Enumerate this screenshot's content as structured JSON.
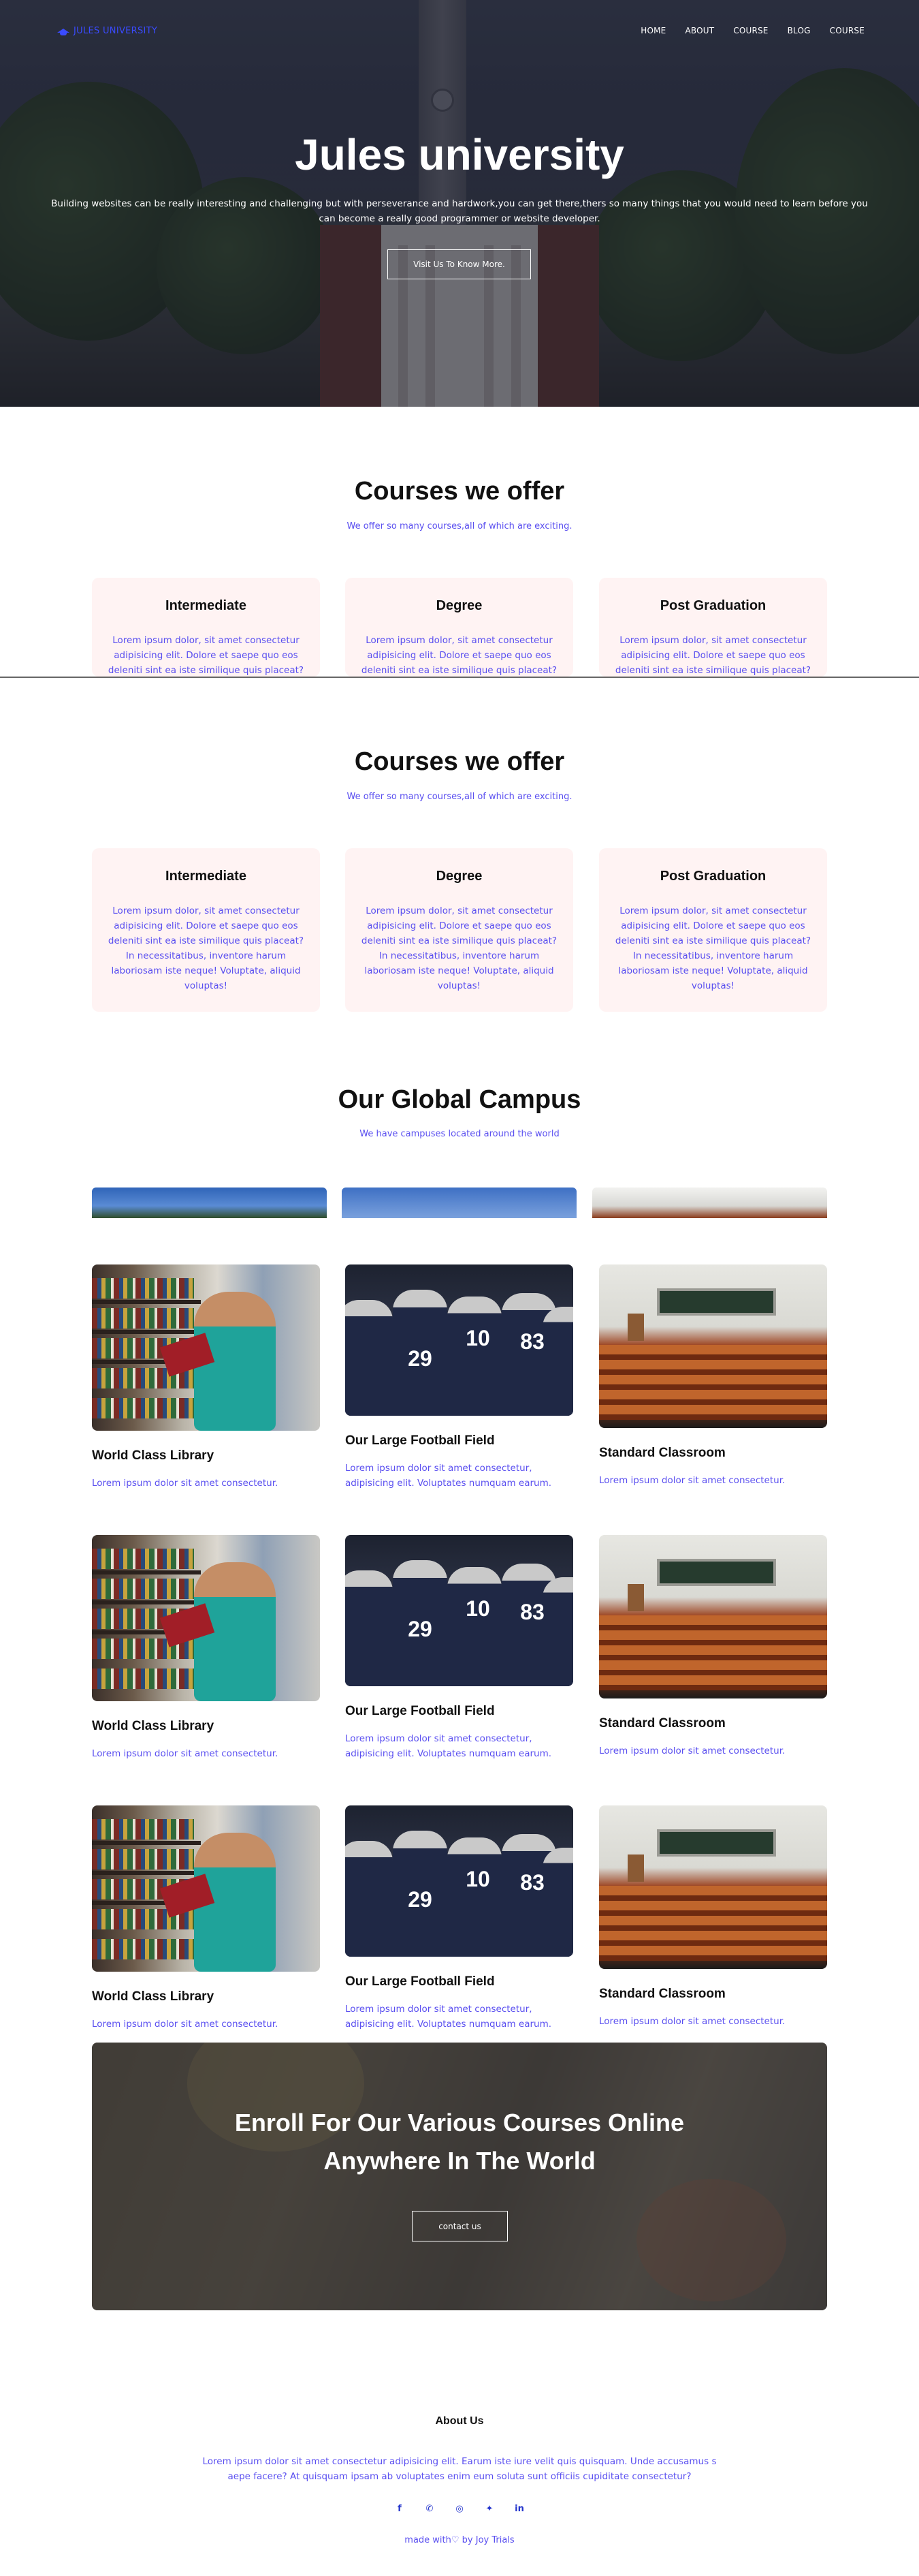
{
  "nav": {
    "brand": "JULES UNIVERSITY",
    "links": [
      "HOME",
      "ABOUT",
      "COURSE",
      "BLOG",
      "COURSE"
    ]
  },
  "hero": {
    "title": "Jules university",
    "subtitle": "Building websites can be really interesting and challenging but with perseverance and hardwork,you can get there,thers so many things that you would need to learn before you can become a really good programmer or website developer.",
    "button": "Visit Us To Know More."
  },
  "courses": {
    "title": "Courses we offer",
    "subtitle": "We offer so many courses,all of which are exciting.",
    "cards": [
      {
        "title": "Intermediate",
        "text": "Lorem ipsum dolor, sit amet consectetur adipisicing elit. Dolore et saepe quo eos deleniti sint ea iste similique quis placeat? In necessitatibus, inventore harum laboriosam iste neque! Voluptate, aliquid voluptas!"
      },
      {
        "title": "Degree",
        "text": "Lorem ipsum dolor, sit amet consectetur adipisicing elit. Dolore et saepe quo eos deleniti sint ea iste similique quis placeat? In necessitatibus, inventore harum laboriosam iste neque! Voluptate, aliquid voluptas!"
      },
      {
        "title": "Post Graduation",
        "text": "Lorem ipsum dolor, sit amet consectetur adipisicing elit. Dolore et saepe quo eos deleniti sint ea iste similique quis placeat? In necessitatibus, inventore harum laboriosam iste neque! Voluptate, aliquid voluptas!"
      }
    ]
  },
  "campus": {
    "title": "Our Global Campus",
    "subtitle": "We have campuses located around the world",
    "facilities": [
      {
        "title": "World Class Library",
        "text": "Lorem ipsum dolor sit amet consectetur."
      },
      {
        "title": "Our Large Football Field",
        "text": "Lorem ipsum dolor sit amet consectetur, adipisicing elit. Voluptates numquam earum."
      },
      {
        "title": "Standard Classroom",
        "text": "Lorem ipsum dolor sit amet consectetur."
      }
    ],
    "jerseys": [
      "29",
      "10",
      "83"
    ]
  },
  "enroll": {
    "title_line1": "Enroll For Our Various Courses Online",
    "title_line2": "Anywhere In The World",
    "button": "contact us"
  },
  "footer": {
    "about_title": "About Us",
    "about_text": "Lorem ipsum dolor sit amet consectetur adipisicing elit. Earum iste iure velit quis quisquam. Unde accusamus s aepe facere? At quisquam ipsam ab voluptates enim eum soluta sunt officiis cupiditate consectetur?",
    "socials": [
      "facebook-icon",
      "whatsapp-icon",
      "instagram-icon",
      "twitter-icon",
      "linkedin-icon"
    ],
    "credit": "made with♡ by Joy Trials"
  },
  "colors": {
    "accent": "#5a4ff0",
    "brand": "#3a4bff",
    "card_bg": "#fff3f3"
  }
}
